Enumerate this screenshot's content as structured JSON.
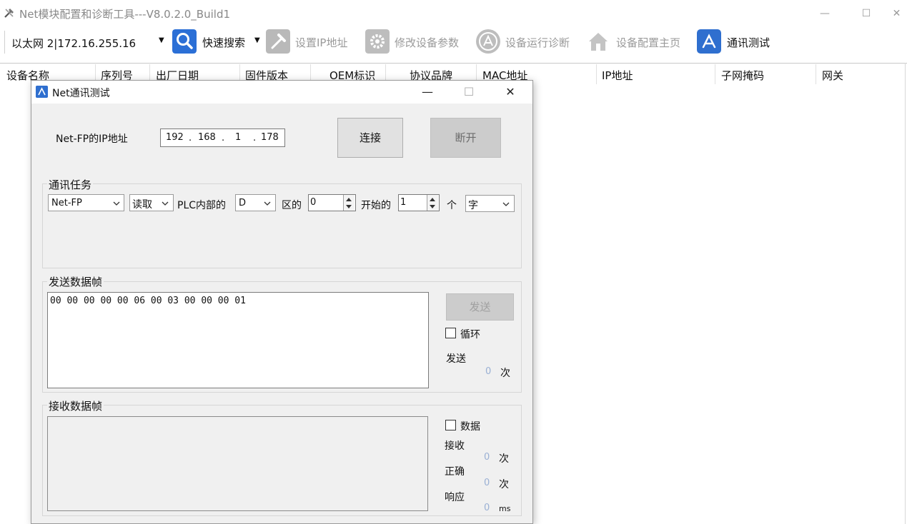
{
  "window": {
    "title": "Net模块配置和诊断工具---V8.0.2.0_Build1",
    "minimize": "—",
    "maximize": "☐",
    "close": "✕"
  },
  "toolbar": {
    "connection": "以太网 2|172.16.255.16",
    "dropdown_arrow": "▼",
    "quick_search": "快速搜索",
    "set_ip": "设置IP地址",
    "modify_params": "修改设备参数",
    "runtime_diag": "设备运行诊断",
    "config_home": "设备配置主页",
    "comm_test": "通讯测试"
  },
  "table": {
    "columns": [
      "设备名称",
      "序列号",
      "出厂日期",
      "固件版本",
      "OEM标识",
      "协议品牌",
      "MAC地址",
      "IP地址",
      "子网掩码",
      "网关"
    ]
  },
  "dialog": {
    "title": "Net通讯测试",
    "minimize": "—",
    "maximize": "☐",
    "close": "✕",
    "ip_label": "Net-FP的IP地址",
    "ip": [
      "192",
      "168",
      "1",
      "178"
    ],
    "ip_dot": ".",
    "connect": "连接",
    "disconnect": "断开",
    "task_group": {
      "title": "通讯任务",
      "protocol": "Net-FP",
      "operation": "读取",
      "plc_internal": "PLC内部的",
      "area": "D",
      "area_of": "区的",
      "start_value": "0",
      "start_label": "开始的",
      "count_value": "1",
      "unit_label": "个",
      "data_type": "字"
    },
    "send_group": {
      "title": "发送数据帧",
      "frame": "00 00 00 00 00 06 00 03 00 00 00 01",
      "send_button": "发送",
      "loop_label": "循环",
      "sent_label": "发送",
      "sent_count": "0",
      "times_unit": "次"
    },
    "recv_group": {
      "title": "接收数据帧",
      "data_label": "数据",
      "received_label": "接收",
      "received_count": "0",
      "correct_label": "正确",
      "correct_count": "0",
      "times_unit": "次",
      "response_label": "响应",
      "response_value": "0",
      "ms_unit": "ms"
    }
  }
}
